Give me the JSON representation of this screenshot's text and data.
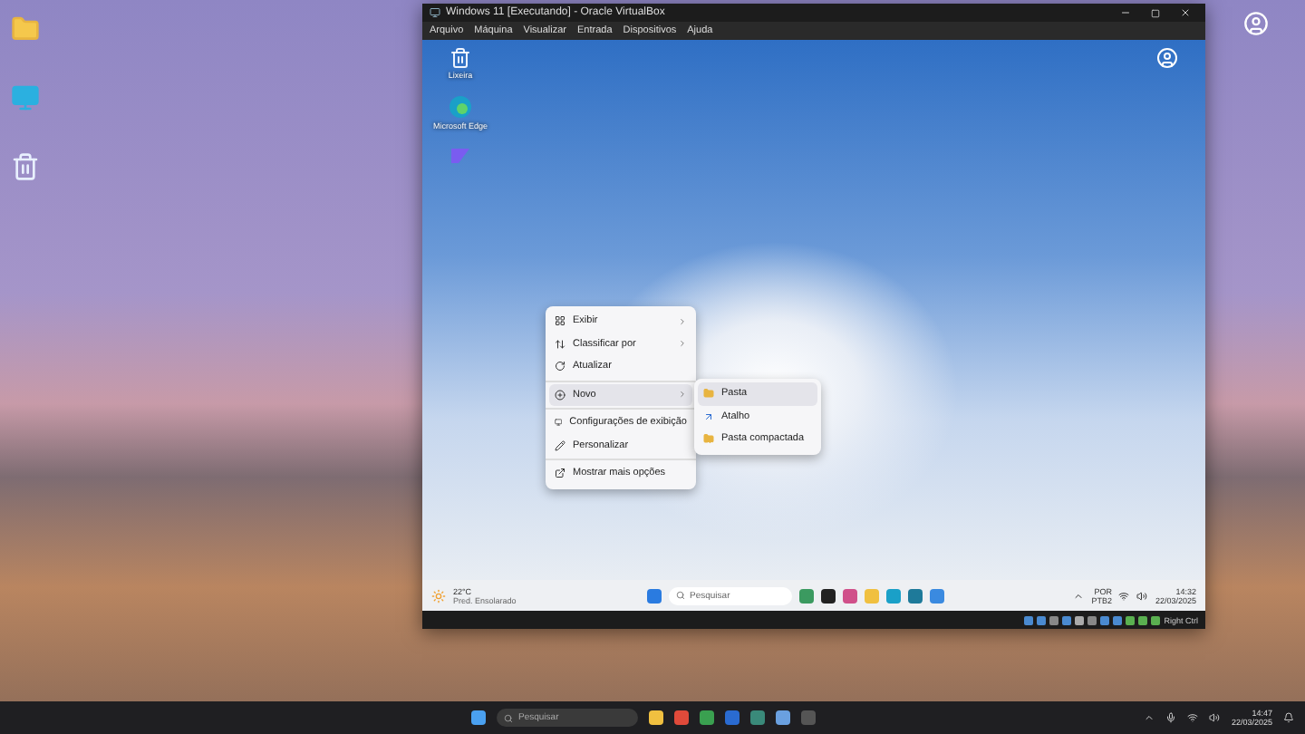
{
  "host_desktop": {
    "icons": [
      {
        "kind": "folder"
      },
      {
        "kind": "monitor"
      },
      {
        "kind": "recycle"
      }
    ]
  },
  "vm_window": {
    "title": "Windows 11 [Executando] - Oracle VirtualBox",
    "menu": [
      "Arquivo",
      "Máquina",
      "Visualizar",
      "Entrada",
      "Dispositivos",
      "Ajuda"
    ]
  },
  "vm_desktop": {
    "icons": [
      {
        "kind": "recycle",
        "label": "Lixeira"
      },
      {
        "kind": "edge",
        "label": "Microsoft Edge"
      },
      {
        "kind": "app"
      }
    ]
  },
  "context_menu": {
    "items": [
      {
        "kind": "item",
        "label": "Exibir",
        "submenu": true,
        "selected": false
      },
      {
        "kind": "item",
        "label": "Classificar por",
        "submenu": true,
        "selected": false
      },
      {
        "kind": "item",
        "label": "Atualizar",
        "submenu": false,
        "selected": false
      },
      {
        "kind": "separator"
      },
      {
        "kind": "item",
        "label": "Novo",
        "submenu": true,
        "selected": true
      },
      {
        "kind": "separator"
      },
      {
        "kind": "item",
        "label": "Configurações de exibição",
        "submenu": false,
        "selected": false
      },
      {
        "kind": "item",
        "label": "Personalizar",
        "submenu": false,
        "selected": false
      },
      {
        "kind": "separator"
      },
      {
        "kind": "item",
        "label": "Mostrar mais opções",
        "submenu": false,
        "selected": false
      }
    ]
  },
  "submenu": [
    {
      "label": "Pasta",
      "selected": true
    },
    {
      "label": "Atalho",
      "selected": false
    },
    {
      "label": "Pasta compactada",
      "selected": false
    }
  ],
  "vm_taskbar": {
    "temperature": "22°C",
    "weather": "Pred. Ensolarado",
    "search_placeholder": "Pesquisar",
    "language": "POR",
    "layout": "PTB2",
    "time": "14:32",
    "date": "22/03/2025"
  },
  "status_bar": {
    "host_key": "Right Ctrl"
  },
  "host_taskbar": {
    "search_placeholder": "Pesquisar",
    "time": "14:47",
    "date": "22/03/2025"
  }
}
